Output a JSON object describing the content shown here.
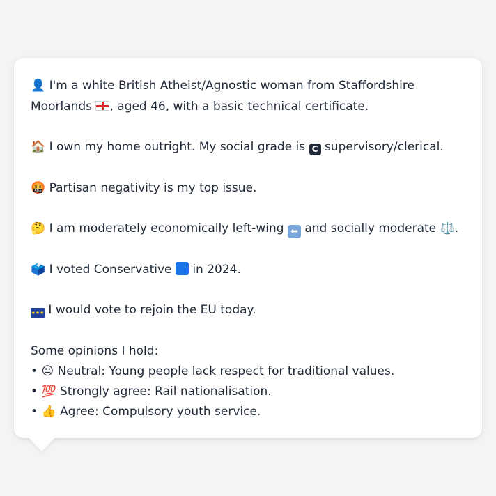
{
  "colors": {
    "background": "#f3f4f6",
    "bubble": "#ffffff",
    "text": "#1f2937",
    "conservative_blue": "#1d73e8"
  },
  "profile": {
    "line1_text": "I'm a white British Atheist/Agnostic woman from Staffordshire Moorlands",
    "line1_emoji": "👤",
    "line1_flag_icon": "england-flag-icon",
    "line1_after_flag": ", aged 46, with a basic technical certificate.",
    "home_emoji": "🏠",
    "home_text": "I own my home outright. My social grade is",
    "grade_badge": "C",
    "grade_text": "supervisory/clerical.",
    "issue_emoji": "🤬",
    "issue_text": "Partisan negativity is my top issue.",
    "ideology_emoji": "🤔",
    "ideology_text_1": "I am moderately economically left-wing",
    "ideology_arrow": "⬅",
    "ideology_text_2": "and socially moderate",
    "ideology_scale_emoji": "⚖️",
    "ideology_end": ".",
    "vote_emoji": "🗳️",
    "vote_text_1": "I voted Conservative",
    "vote_text_2": "in 2024.",
    "eu_flag_stars": "★★★",
    "eu_text": "I would vote to rejoin the EU today."
  },
  "opinions": {
    "heading": "Some opinions I hold:",
    "items": [
      {
        "bullet": "•",
        "emoji": "😐",
        "text": "Neutral: Young people lack respect for traditional values."
      },
      {
        "bullet": "•",
        "emoji": "💯",
        "text": "Strongly agree: Rail nationalisation."
      },
      {
        "bullet": "•",
        "emoji": "👍",
        "text": "Agree: Compulsory youth service."
      }
    ]
  }
}
